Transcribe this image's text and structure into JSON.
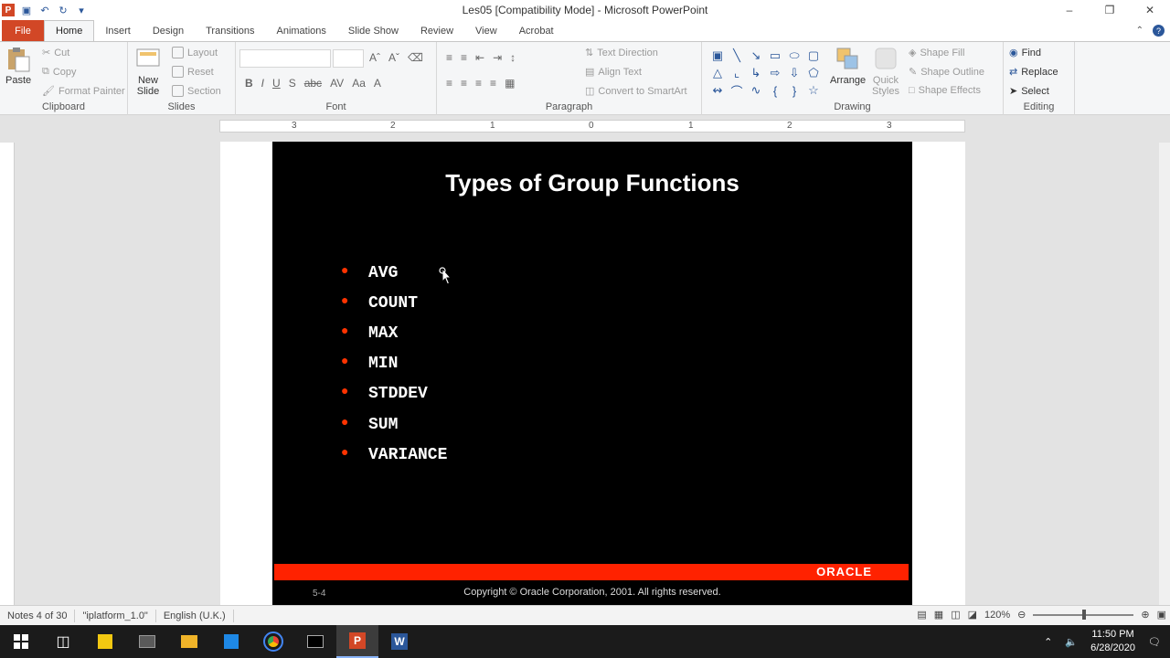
{
  "window": {
    "title": "Les05 [Compatibility Mode]  -  Microsoft PowerPoint"
  },
  "tabs": [
    "File",
    "Home",
    "Insert",
    "Design",
    "Transitions",
    "Animations",
    "Slide Show",
    "Review",
    "View",
    "Acrobat"
  ],
  "ribbon": {
    "clipboard": {
      "label": "Clipboard",
      "paste": "Paste",
      "cut": "Cut",
      "copy": "Copy",
      "format_painter": "Format Painter"
    },
    "slides": {
      "label": "Slides",
      "new_slide_line1": "New",
      "new_slide_line2": "Slide",
      "layout": "Layout",
      "reset": "Reset",
      "section": "Section"
    },
    "font": {
      "label": "Font"
    },
    "paragraph": {
      "label": "Paragraph",
      "text_direction": "Text Direction",
      "align_text": "Align Text",
      "convert_smartart": "Convert to SmartArt"
    },
    "drawing": {
      "label": "Drawing",
      "arrange": "Arrange",
      "quick_styles_line1": "Quick",
      "quick_styles_line2": "Styles",
      "shape_fill": "Shape Fill",
      "shape_outline": "Shape Outline",
      "shape_effects": "Shape Effects"
    },
    "editing": {
      "label": "Editing",
      "find": "Find",
      "replace": "Replace",
      "select": "Select"
    }
  },
  "ruler": {
    "marks": [
      "3",
      "2",
      "1",
      "0",
      "1",
      "2",
      "3"
    ]
  },
  "slide": {
    "title": "Types of Group Functions",
    "bullets": [
      "AVG",
      "COUNT",
      "MAX",
      "MIN",
      "STDDEV",
      "SUM",
      "VARIANCE"
    ],
    "brand": "ORACLE",
    "number": "5-4",
    "copyright": "Copyright © Oracle Corporation, 2001. All rights reserved.",
    "accent_color": "#ff2200"
  },
  "status": {
    "notes": "Notes 4 of 30",
    "theme": "\"iplatform_1.0\"",
    "language": "English (U.K.)",
    "zoom": "120%"
  },
  "taskbar": {
    "time": "11:50 PM",
    "date": "6/28/2020"
  }
}
